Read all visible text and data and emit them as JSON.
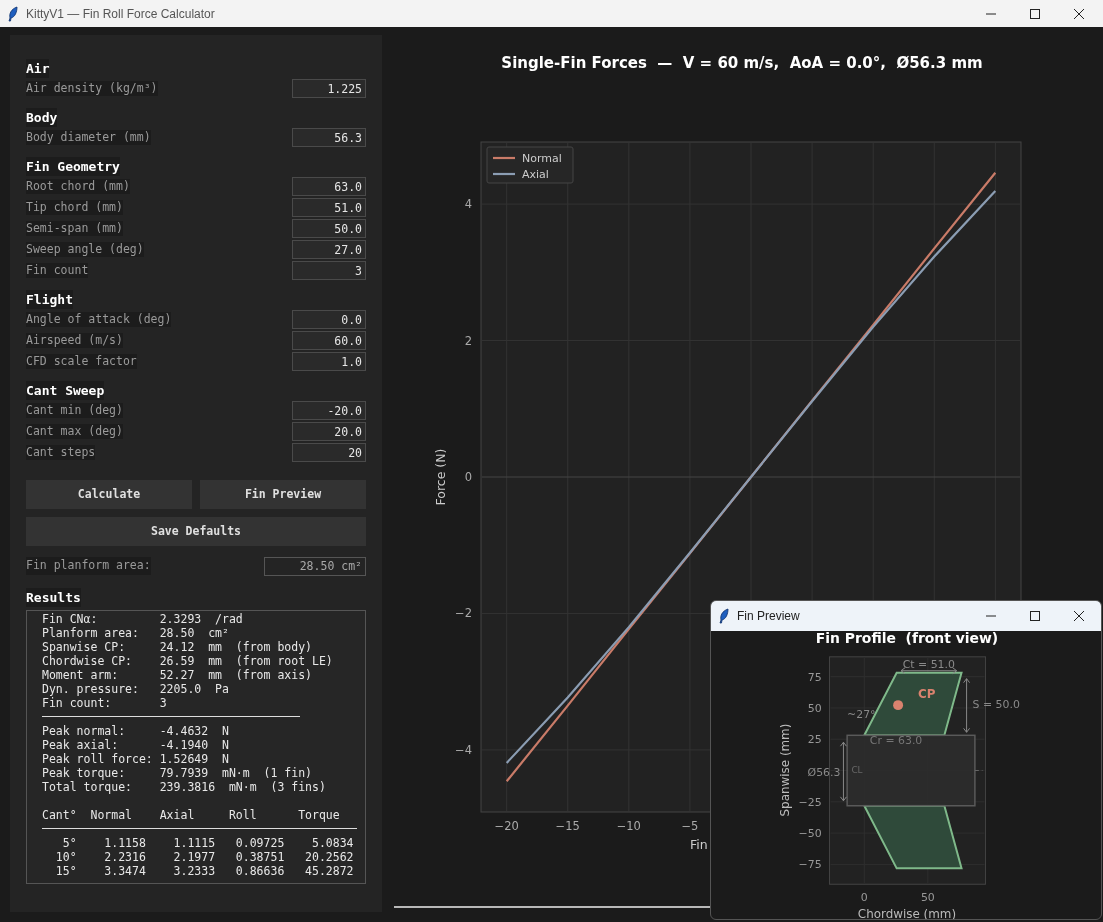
{
  "window": {
    "title": "KittyV1 — Fin Roll Force Calculator"
  },
  "sections": [
    {
      "heading": "Air",
      "fields": [
        {
          "label": "Air density (kg/m³)",
          "value": "1.225"
        }
      ]
    },
    {
      "heading": "Body",
      "fields": [
        {
          "label": "Body diameter (mm)",
          "value": "56.3"
        }
      ]
    },
    {
      "heading": "Fin Geometry",
      "fields": [
        {
          "label": "Root chord (mm)",
          "value": "63.0"
        },
        {
          "label": "Tip chord (mm)",
          "value": "51.0"
        },
        {
          "label": "Semi-span (mm)",
          "value": "50.0"
        },
        {
          "label": "Sweep angle (deg)",
          "value": "27.0"
        },
        {
          "label": "Fin count",
          "value": "3"
        }
      ]
    },
    {
      "heading": "Flight",
      "fields": [
        {
          "label": "Angle of attack (deg)",
          "value": "0.0"
        },
        {
          "label": "Airspeed (m/s)",
          "value": "60.0"
        },
        {
          "label": "CFD scale factor",
          "value": "1.0"
        }
      ]
    },
    {
      "heading": "Cant Sweep",
      "fields": [
        {
          "label": "Cant min (deg)",
          "value": "-20.0"
        },
        {
          "label": "Cant max (deg)",
          "value": "20.0"
        },
        {
          "label": "Cant steps",
          "value": "20"
        }
      ]
    }
  ],
  "buttons": [
    "Calculate",
    "Fin Preview"
  ],
  "save_button": "Save Defaults",
  "planform": {
    "label": "Fin planform area:",
    "value": "28.50 cm²"
  },
  "results": {
    "heading": "Results",
    "summary": [
      {
        "label": "Fin CNα:",
        "value": "2.3293  /rad"
      },
      {
        "label": "Planform area:",
        "value": "28.50  cm²"
      },
      {
        "label": "Spanwise CP:",
        "value": "24.12  mm  (from body)"
      },
      {
        "label": "Chordwise CP:",
        "value": "26.59  mm  (from root LE)"
      },
      {
        "label": "Moment arm:",
        "value": "52.27  mm  (from axis)"
      },
      {
        "label": "Dyn. pressure:",
        "value": "2205.0  Pa"
      },
      {
        "label": "Fin count:",
        "value": "3"
      }
    ],
    "peaks": [
      {
        "label": "Peak normal:",
        "value": "-4.4632  N"
      },
      {
        "label": "Peak axial:",
        "value": "-4.1940  N"
      },
      {
        "label": "Peak roll force:",
        "value": "1.52649  N"
      },
      {
        "label": "Peak torque:",
        "value": "79.7939  mN·m  (1 fin)"
      },
      {
        "label": "Total torque:",
        "value": "239.3816  mN·m  (3 fins)"
      }
    ],
    "columns": [
      "Cant°",
      "Normal",
      "Axial",
      "Roll",
      "Torque"
    ],
    "rows": [
      [
        "5°",
        "1.1158",
        "1.1115",
        "0.09725",
        "5.0834"
      ],
      [
        "10°",
        "2.2316",
        "2.1977",
        "0.38751",
        "20.2562"
      ],
      [
        "15°",
        "3.3474",
        "3.2333",
        "0.86636",
        "45.2872"
      ]
    ]
  },
  "chart": {
    "chart_data": {
      "type": "line",
      "title": "Single-Fin Forces  —  V = 60 m/s,  AoA = 0.0°,  Ø56.3 mm",
      "xlabel": "Fin",
      "ylabel": "Force (N)",
      "x": [
        -20,
        -15,
        -10,
        -5,
        0,
        5,
        10,
        15,
        20
      ],
      "series": [
        {
          "name": "Normal",
          "color": "#c97b68",
          "values": [
            -4.46,
            -3.35,
            -2.23,
            -1.12,
            0,
            1.12,
            2.23,
            3.35,
            4.46
          ]
        },
        {
          "name": "Axial",
          "color": "#8b9db3",
          "values": [
            -4.19,
            -3.23,
            -2.2,
            -1.11,
            0,
            1.11,
            2.2,
            3.23,
            4.19
          ]
        }
      ],
      "grid": true,
      "legend": true,
      "xlim": [
        -22.1,
        22.1
      ],
      "ylim": [
        -4.91,
        4.91
      ],
      "xticks": [
        {
          "value": -20,
          "label": "−20"
        },
        {
          "value": -15,
          "label": "−15"
        },
        {
          "value": -10,
          "label": "−10"
        },
        {
          "value": -5,
          "label": "−5"
        }
      ],
      "yticks": [
        {
          "value": -4,
          "label": "−4"
        },
        {
          "value": -2,
          "label": "−2"
        },
        {
          "value": 0,
          "label": "0"
        },
        {
          "value": 2,
          "label": "2"
        },
        {
          "value": 4,
          "label": "4"
        }
      ]
    }
  },
  "fin_preview": {
    "title": "Fin Preview",
    "plot_title": "Fin Profile  (front view)",
    "xlabel": "Chordwise (mm)",
    "ylabel": "Spanwise (mm)",
    "xtick_labels": [
      "0",
      "50"
    ],
    "ytick_labels": [
      "75",
      "50",
      "25",
      "−25",
      "−50",
      "−75"
    ],
    "annotations": [
      "Ct = 51.0",
      "S = 50.0",
      "Cr = 63.0",
      "~27°",
      "Ø56.3",
      "CL",
      "CP"
    ]
  }
}
